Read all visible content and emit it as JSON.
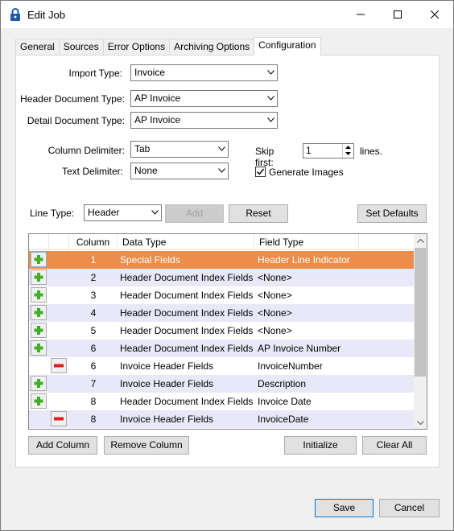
{
  "window": {
    "title": "Edit Job"
  },
  "tabs": [
    {
      "label": "General"
    },
    {
      "label": "Sources"
    },
    {
      "label": "Error Options"
    },
    {
      "label": "Archiving Options"
    },
    {
      "label": "Configuration"
    }
  ],
  "form": {
    "import_type_label": "Import Type:",
    "import_type_value": "Invoice",
    "header_doc_type_label": "Header Document Type:",
    "header_doc_type_value": "AP Invoice",
    "detail_doc_type_label": "Detail Document Type:",
    "detail_doc_type_value": "AP Invoice",
    "column_delim_label": "Column Delimiter:",
    "column_delim_value": "Tab",
    "text_delim_label": "Text Delimiter:",
    "text_delim_value": "None",
    "skip_first_label": "Skip first:",
    "skip_first_value": "1",
    "lines_label": "lines.",
    "generate_images_label": "Generate Images",
    "generate_images_checked": true,
    "line_type_label": "Line Type:",
    "line_type_value": "Header"
  },
  "buttons": {
    "add": "Add",
    "reset": "Reset",
    "set_defaults": "Set Defaults",
    "add_column": "Add Column",
    "remove_column": "Remove Column",
    "initialize": "Initialize",
    "clear_all": "Clear All",
    "save": "Save",
    "cancel": "Cancel"
  },
  "grid": {
    "headers": [
      "Column",
      "Data Type",
      "Field Type"
    ],
    "rows": [
      {
        "toggle": "plus",
        "column": "1",
        "data_type": "Special Fields",
        "field_type": "Header Line Indicator",
        "selected": true
      },
      {
        "toggle": "plus",
        "column": "2",
        "data_type": "Header Document Index Fields",
        "field_type": "<None>"
      },
      {
        "toggle": "plus",
        "column": "3",
        "data_type": "Header Document Index Fields",
        "field_type": "<None>"
      },
      {
        "toggle": "plus",
        "column": "4",
        "data_type": "Header Document Index Fields",
        "field_type": "<None>"
      },
      {
        "toggle": "plus",
        "column": "5",
        "data_type": "Header Document Index Fields",
        "field_type": "<None>"
      },
      {
        "toggle": "plus",
        "column": "6",
        "data_type": "Header Document Index Fields",
        "field_type": "AP Invoice Number"
      },
      {
        "toggle": "minus",
        "column": "6",
        "data_type": "Invoice Header Fields",
        "field_type": "InvoiceNumber"
      },
      {
        "toggle": "plus",
        "column": "7",
        "data_type": "Invoice Header Fields",
        "field_type": "Description"
      },
      {
        "toggle": "plus",
        "column": "8",
        "data_type": "Header Document Index Fields",
        "field_type": "Invoice Date"
      },
      {
        "toggle": "minus",
        "column": "8",
        "data_type": "Invoice Header Fields",
        "field_type": "InvoiceDate"
      }
    ]
  },
  "colors": {
    "selected_row": "#ed8d4b",
    "alt_row": "#e8e8f8",
    "plus_icon": "#3fae29",
    "minus_icon": "#e01b1b"
  }
}
